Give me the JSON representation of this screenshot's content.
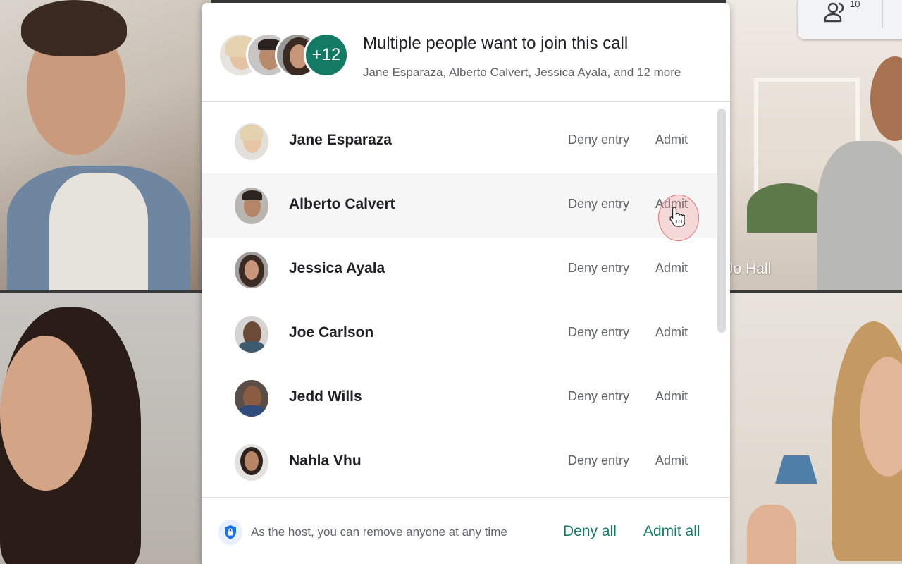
{
  "background": {
    "tile_names": {
      "top_right": "Jo Hall"
    },
    "people_count": "10"
  },
  "dialog": {
    "title": "Multiple people want to join this call",
    "subtitle": "Jane Esparaza, Alberto Calvert, Jessica Ayala, and 12 more",
    "extra_count": "+12",
    "accent_color": "#137a64",
    "requests": [
      {
        "name": "Jane Esparaza",
        "deny_label": "Deny entry",
        "admit_label": "Admit"
      },
      {
        "name": "Alberto Calvert",
        "deny_label": "Deny entry",
        "admit_label": "Admit"
      },
      {
        "name": "Jessica Ayala",
        "deny_label": "Deny entry",
        "admit_label": "Admit"
      },
      {
        "name": "Joe Carlson",
        "deny_label": "Deny entry",
        "admit_label": "Admit"
      },
      {
        "name": "Jedd Wills",
        "deny_label": "Deny entry",
        "admit_label": "Admit"
      },
      {
        "name": "Nahla Vhu",
        "deny_label": "Deny entry",
        "admit_label": "Admit"
      }
    ],
    "footer": {
      "note": "As the host, you can remove anyone at any time",
      "deny_all": "Deny all",
      "admit_all": "Admit all"
    }
  }
}
